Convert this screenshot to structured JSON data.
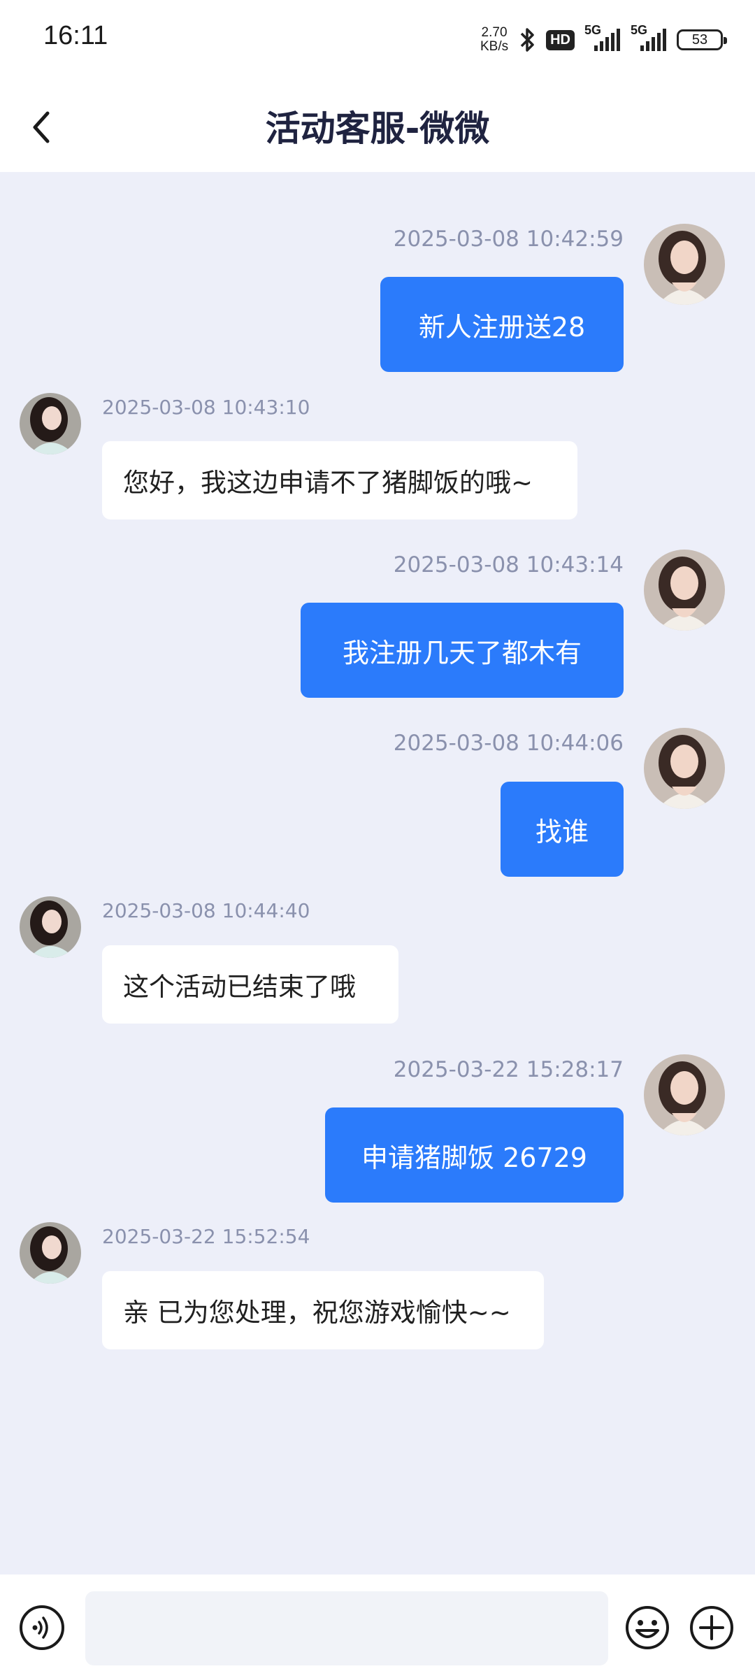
{
  "status_bar": {
    "time": "16:11",
    "net_speed_value": "2.70",
    "net_speed_unit": "KB/s",
    "hd_label": "HD",
    "sim1_label": "5G",
    "sim2_label": "5G",
    "battery": "53"
  },
  "header": {
    "title": "活动客服-微微"
  },
  "messages": [
    {
      "side": "out",
      "timestamp": "2025-03-08 10:42:59",
      "text": "新人注册送28"
    },
    {
      "side": "in",
      "timestamp": "2025-03-08 10:43:10",
      "text": "您好，我这边申请不了猪脚饭的哦~"
    },
    {
      "side": "out",
      "timestamp": "2025-03-08 10:43:14",
      "text": "我注册几天了都木有"
    },
    {
      "side": "out",
      "timestamp": "2025-03-08 10:44:06",
      "text": "找谁"
    },
    {
      "side": "in",
      "timestamp": "2025-03-08 10:44:40",
      "text": "这个活动已结束了哦"
    },
    {
      "side": "out",
      "timestamp": "2025-03-22 15:28:17",
      "text": "申请猪脚饭 26729"
    },
    {
      "side": "in",
      "timestamp": "2025-03-22 15:52:54",
      "text": "亲 已为您处理，祝您游戏愉快~~"
    }
  ],
  "input": {
    "placeholder": ""
  },
  "colors": {
    "outgoing_bubble": "#2b7bfb",
    "chat_background": "#edeff9",
    "timestamp": "#8a91ad"
  },
  "icons": [
    "back-arrow-icon",
    "bluetooth-icon",
    "voice-icon",
    "emoji-icon",
    "plus-icon"
  ]
}
